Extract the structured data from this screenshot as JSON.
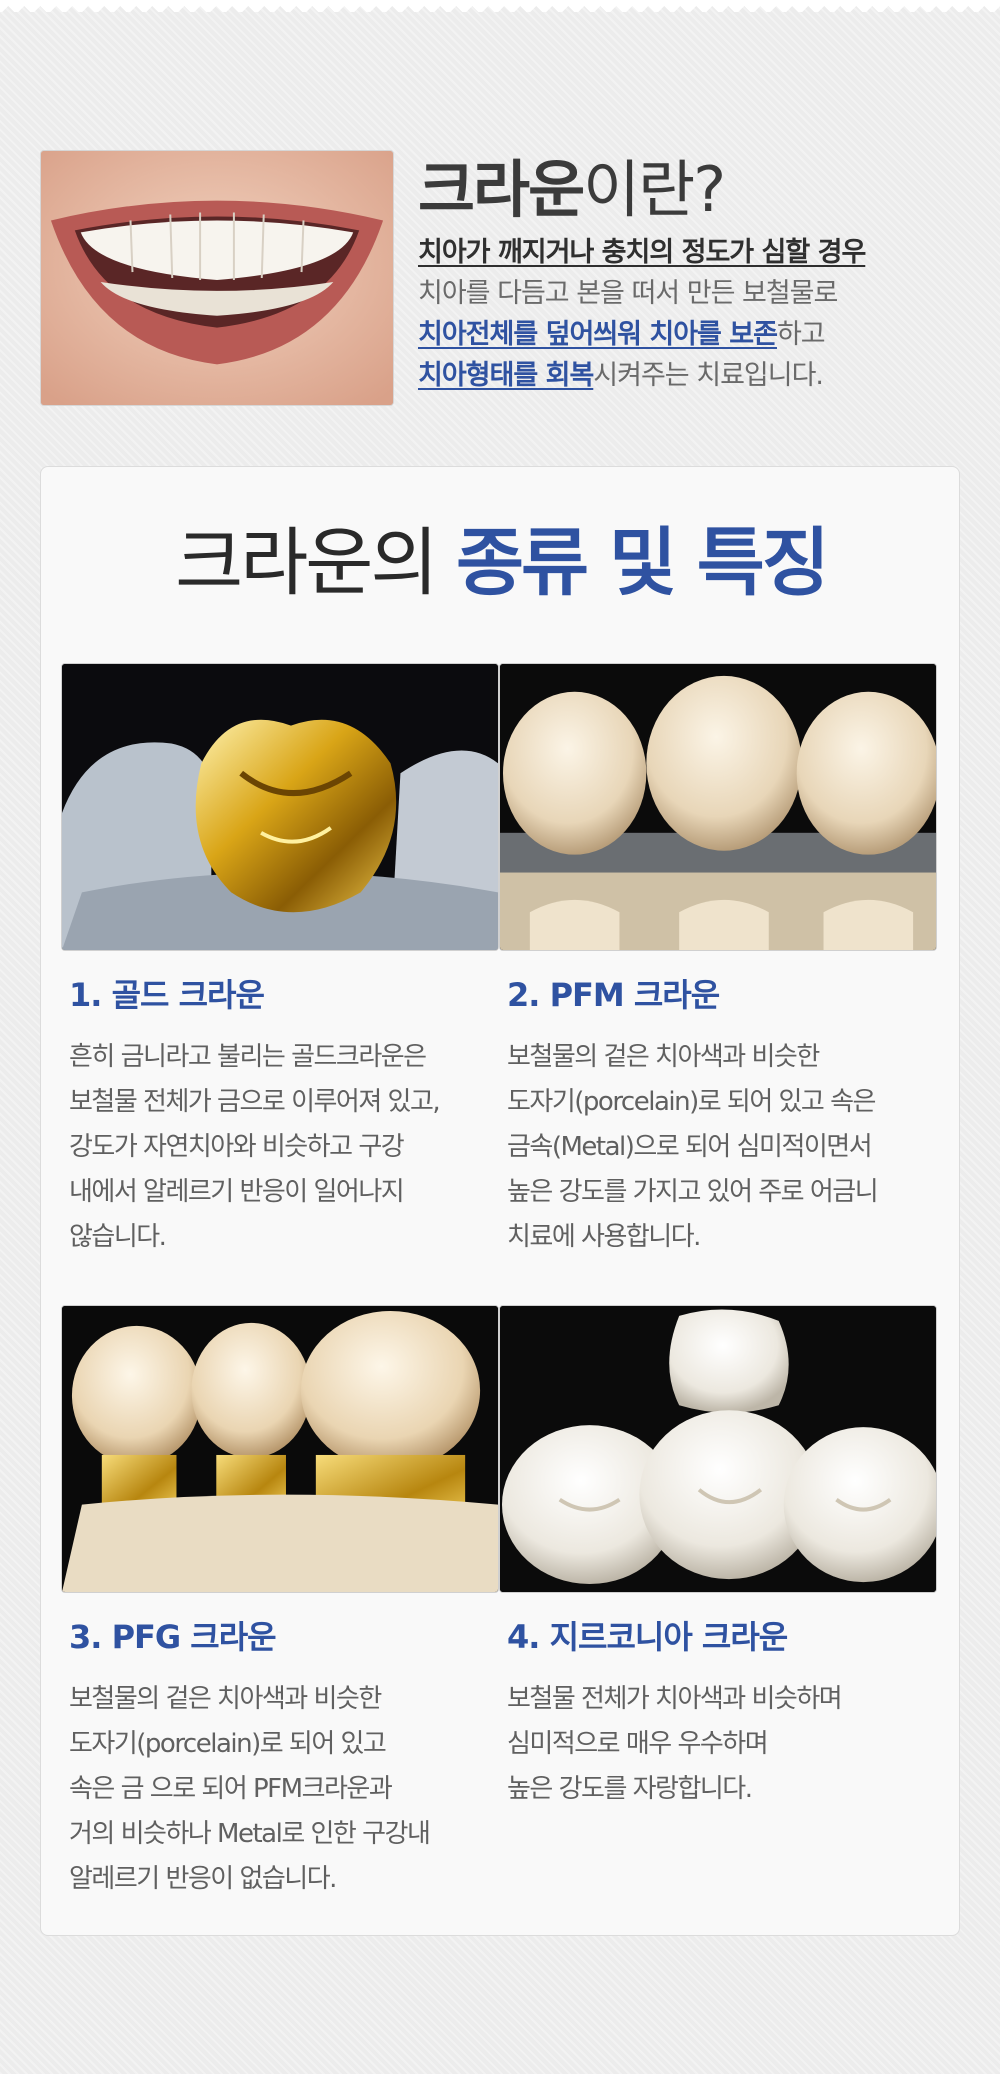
{
  "intro": {
    "title_strong": "크라운",
    "title_rest": "이란?",
    "line1": "치아가 깨지거나 충치의 정도가 심할 경우",
    "line2": "치아를 다듬고 본을 떠서 만든 보철물로",
    "line3_hl": "치아전체를 덮어씌워 치아를 보존",
    "line3_rest": "하고",
    "line4_hl": "치아형태를 회복",
    "line4_rest": "시켜주는 치료입니다."
  },
  "section": {
    "title_plain": "크라운의 ",
    "title_accent": "종류 및 특징"
  },
  "items": [
    {
      "heading": "1. 골드 크라운",
      "lines": [
        "흔히 금니라고 불리는 골드크라운은",
        "보철물 전체가 금으로 이루어져 있고,",
        "강도가 자연치아와 비슷하고 구강",
        "내에서 알레르기 반응이 일어나지",
        "않습니다."
      ],
      "image_icon": "gold-crown-photo"
    },
    {
      "heading": "2. PFM 크라운",
      "lines": [
        "보철물의 겉은 치아색과 비슷한",
        "도자기(porcelain)로 되어 있고 속은",
        "금속(Metal)으로 되어 심미적이면서",
        "높은 강도를 가지고 있어 주로 어금니",
        "치료에 사용합니다."
      ],
      "image_icon": "pfm-crown-photo"
    },
    {
      "heading": "3. PFG 크라운",
      "lines": [
        "보철물의 겉은 치아색과 비슷한",
        "도자기(porcelain)로 되어 있고",
        "속은 금 으로 되어 PFM크라운과",
        "거의 비슷하나 Metal로 인한 구강내",
        "알레르기 반응이 없습니다."
      ],
      "image_icon": "pfg-crown-photo"
    },
    {
      "heading": "4. 지르코니아 크라운",
      "lines": [
        "보철물 전체가 치아색과 비슷하며",
        "심미적으로 매우 우수하며",
        "높은 강도를 자랑합니다."
      ],
      "image_icon": "zirconia-crown-photo"
    }
  ],
  "colors": {
    "accent": "#2f52a1",
    "background": "#ececec",
    "card": "#f9f9f9"
  }
}
